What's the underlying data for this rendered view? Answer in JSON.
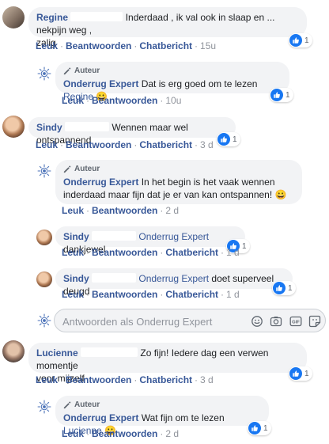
{
  "labels": {
    "like": "Leuk",
    "reply": "Beantwoorden",
    "chat": "Chatbericht",
    "author_badge": "Auteur"
  },
  "c1": {
    "name": "Regine",
    "text_a": "Inderdaad , ik val ook in slaap en ... nekpijn weg ,",
    "text_b": "zalig",
    "time": "15u",
    "reactions": "1"
  },
  "r1": {
    "name": "Onderrug Expert",
    "text": "Dat is erg goed om te lezen",
    "mention": "Regine",
    "emoji": "😀",
    "time": "10u",
    "reactions": "1"
  },
  "c2": {
    "name": "Sindy",
    "text": "Wennen maar wel ontspannend",
    "time": "3 d",
    "reactions": "1"
  },
  "r2": {
    "name": "Onderrug Expert",
    "text_a": "In het begin is het vaak wennen",
    "text_b": "inderdaad maar fijn dat je er van kan ontspannen!",
    "emoji": "😀",
    "time": "2 d"
  },
  "r3": {
    "name": "Sindy",
    "mention": "Onderrug Expert",
    "text": "dankjewel",
    "time": "1 d",
    "reactions": "1"
  },
  "r4": {
    "name": "Sindy",
    "mention": "Onderrug Expert",
    "text": "doet superveel deugd",
    "time": "1 d",
    "reactions": "1"
  },
  "reply_box": {
    "placeholder": "Antwoorden als Onderrug Expert"
  },
  "c3": {
    "name": "Lucienne",
    "text_a": "Zo fijn! Iedere dag een verwen momentje",
    "text_b": "voor mijzelf",
    "time": "3 d",
    "reactions": "1"
  },
  "r5": {
    "name": "Onderrug Expert",
    "text": "Wat fijn om te lezen",
    "mention": "Lucienne",
    "emoji": "😀",
    "time": "2 d",
    "reactions": "1"
  }
}
